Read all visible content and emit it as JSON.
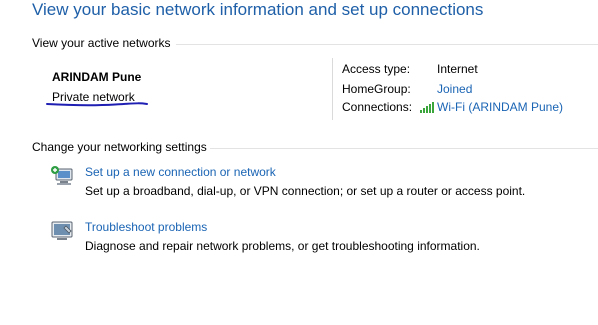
{
  "header": {
    "title": "View your basic network information and set up connections"
  },
  "active_networks": {
    "section_label": "View your active networks",
    "network_name": "ARINDAM Pune",
    "network_type": "Private network",
    "details": {
      "access_type_label": "Access type:",
      "access_type_value": "Internet",
      "homegroup_label": "HomeGroup:",
      "homegroup_value": "Joined",
      "connections_label": "Connections:",
      "connections_value": "Wi-Fi (ARINDAM Pune)"
    }
  },
  "networking_settings": {
    "section_label": "Change your networking settings",
    "tasks": [
      {
        "icon": "network-setup-icon",
        "link": "Set up a new connection or network",
        "description": "Set up a broadband, dial-up, or VPN connection; or set up a router or access point."
      },
      {
        "icon": "troubleshoot-icon",
        "link": "Troubleshoot problems",
        "description": "Diagnose and repair network problems, or get troubleshooting information."
      }
    ]
  },
  "colors": {
    "title_blue": "#1e5fa8",
    "link_blue": "#1a64b4",
    "annotation_ink": "#1f1fb4",
    "wifi_green": "#3aa53a"
  }
}
